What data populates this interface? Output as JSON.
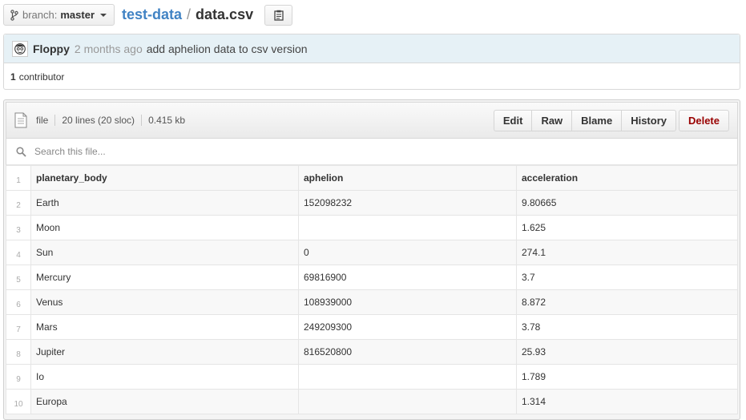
{
  "topbar": {
    "branch_label": "branch:",
    "branch_value": "master",
    "repo": "test-data",
    "separator": "/",
    "file": "data.csv"
  },
  "commit": {
    "author": "Floppy",
    "time": "2 months ago",
    "message": "add aphelion data to csv version",
    "contributors_count": "1",
    "contributors_label": "contributor"
  },
  "file": {
    "type": "file",
    "lines": "20 lines (20 sloc)",
    "size": "0.415 kb",
    "buttons": [
      "Edit",
      "Raw",
      "Blame",
      "History"
    ],
    "delete_label": "Delete",
    "search_placeholder": "Search this file..."
  },
  "table": {
    "columns": [
      "planetary_body",
      "aphelion",
      "acceleration"
    ],
    "rows": [
      {
        "ln": "2",
        "c0": "Earth",
        "c1": "152098232",
        "c2": "9.80665"
      },
      {
        "ln": "3",
        "c0": "Moon",
        "c1": "",
        "c2": "1.625"
      },
      {
        "ln": "4",
        "c0": "Sun",
        "c1": "0",
        "c2": "274.1"
      },
      {
        "ln": "5",
        "c0": "Mercury",
        "c1": "69816900",
        "c2": "3.7"
      },
      {
        "ln": "6",
        "c0": "Venus",
        "c1": "108939000",
        "c2": "8.872"
      },
      {
        "ln": "7",
        "c0": "Mars",
        "c1": "249209300",
        "c2": "3.78"
      },
      {
        "ln": "8",
        "c0": "Jupiter",
        "c1": "816520800",
        "c2": "25.93"
      },
      {
        "ln": "9",
        "c0": "Io",
        "c1": "",
        "c2": "1.789"
      },
      {
        "ln": "10",
        "c0": "Europa",
        "c1": "",
        "c2": "1.314"
      }
    ],
    "header_ln": "1"
  }
}
